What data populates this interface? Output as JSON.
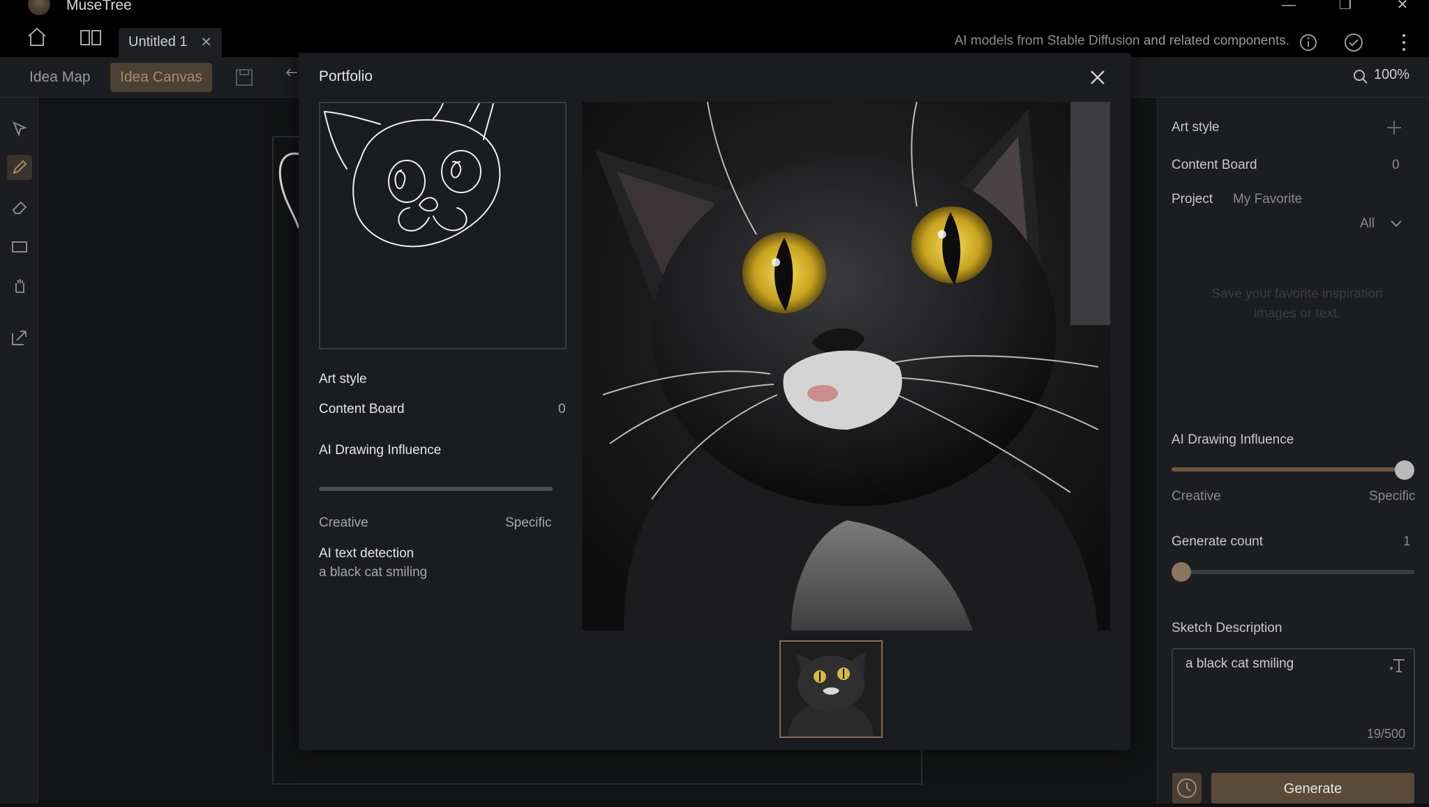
{
  "app": {
    "title": "MuseTree",
    "tab_label": "Untitled 1",
    "models_note": "AI models from Stable Diffusion and related components."
  },
  "toolbar": {
    "idea_map": "Idea Map",
    "idea_canvas": "Idea Canvas",
    "zoom": "100%"
  },
  "right_panel": {
    "art_style": "Art style",
    "content_board": "Content Board",
    "content_board_count": "0",
    "project_label": "Project",
    "project_value": "My Favorite",
    "filter": "All",
    "empty_hint": "Save your favorite inspiration images or text.",
    "ai_influence": "AI Drawing Influence",
    "influence_value": 1.0,
    "creative": "Creative",
    "specific": "Specific",
    "generate_count_label": "Generate count",
    "generate_count": "1",
    "sketch_description_label": "Sketch Description",
    "sketch_description": "a black cat smiling",
    "char_count": "19/500",
    "generate_button": "Generate"
  },
  "modal": {
    "title": "Portfolio",
    "art_style": "Art style",
    "content_board": "Content Board",
    "content_board_count": "0",
    "ai_influence": "AI Drawing Influence",
    "creative": "Creative",
    "specific": "Specific",
    "ai_text_detection": "AI text detection",
    "detected_text": "a black cat smiling"
  },
  "colors": {
    "accent": "#a98c6a",
    "accent_bg": "#4a4034",
    "background": "#1c1d20"
  }
}
